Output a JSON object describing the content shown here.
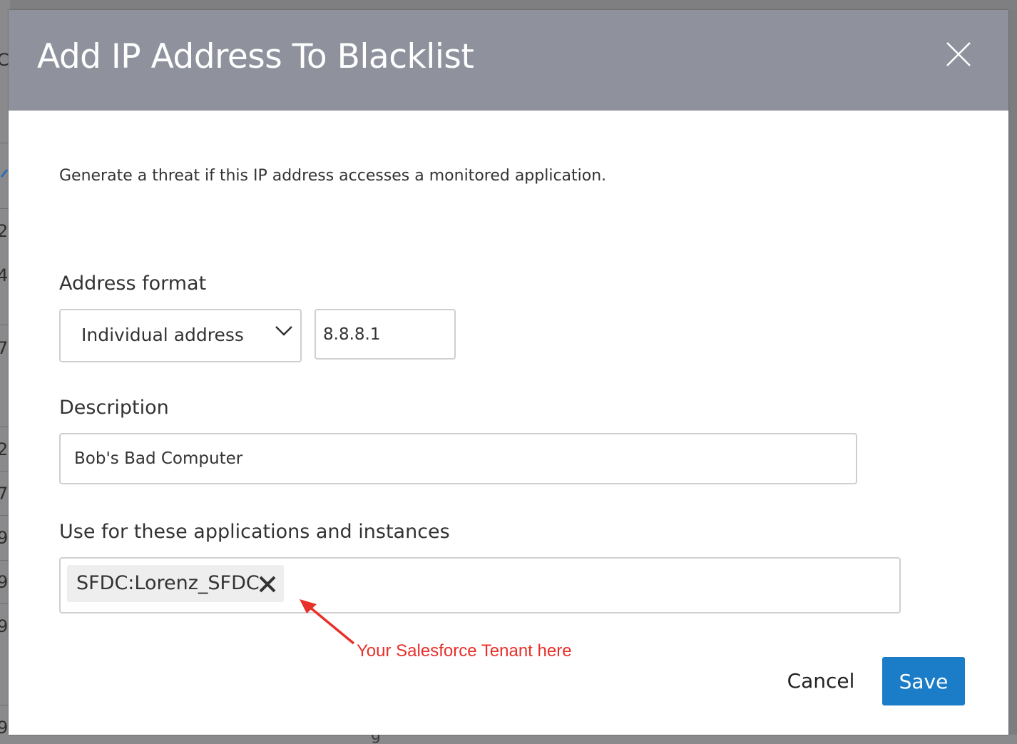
{
  "background": {
    "fragments": [
      "C",
      "2",
      "4",
      "7",
      "2",
      "7",
      "9",
      "9",
      "9",
      "9"
    ],
    "bottom_fragment": "g"
  },
  "modal": {
    "title": "Add IP Address To Blacklist",
    "intro": "Generate a threat if this IP address accesses a monitored application.",
    "address_format": {
      "label": "Address format",
      "selected": "Individual address",
      "ip_value": "8.8.8.1"
    },
    "description": {
      "label": "Description",
      "value": "Bob's Bad Computer"
    },
    "applications": {
      "label": "Use for these applications and instances",
      "tags": [
        "SFDC:Lorenz_SFDC"
      ]
    },
    "annotation": {
      "text": "Your Salesforce Tenant here",
      "color": "#e8302a"
    },
    "actions": {
      "cancel_label": "Cancel",
      "save_label": "Save"
    }
  },
  "colors": {
    "header": "#8f929d",
    "primary": "#1b7dc8",
    "annotation": "#e8302a"
  }
}
